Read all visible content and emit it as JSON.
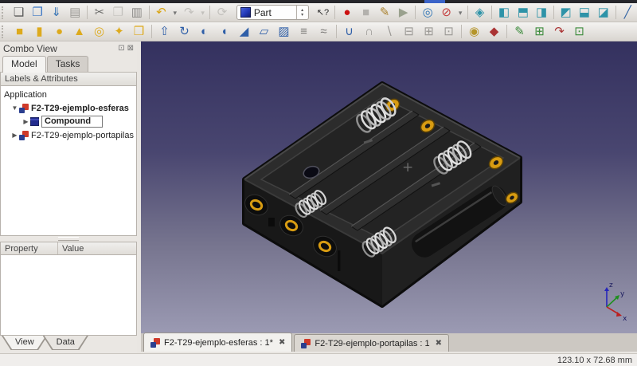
{
  "colors": {
    "viewport_gradient_top": "#34315f",
    "viewport_gradient_bottom": "#9b9ab3",
    "primitive_icon": "#ddaa1d",
    "modify_icon": "#2f5fa8",
    "view_icon": "#2e93a8",
    "record_icon": "#cc1111",
    "undo_icon": "#d9a410"
  },
  "toolbar_file": {
    "items": [
      {
        "name": "new-file",
        "glyph": "❏",
        "style": "color:#5a5a5a"
      },
      {
        "name": "open-file",
        "glyph": "❐",
        "style": "color:#3a76c4"
      },
      {
        "name": "save-file",
        "glyph": "⇓",
        "style": "color:#2f6fb3"
      },
      {
        "name": "print",
        "glyph": "▤",
        "style": "color:#9a9894"
      },
      {
        "name": "cut",
        "glyph": "✂",
        "style": "color:#6f6f6d"
      },
      {
        "name": "copy",
        "glyph": "❐",
        "style": "color:#c3c1bd"
      },
      {
        "name": "paste",
        "glyph": "▥",
        "style": "color:#8a8886"
      },
      {
        "name": "undo",
        "glyph": "↶",
        "style": "color:#d9a410"
      },
      {
        "name": "undo-menu",
        "glyph": "▾",
        "style": "color:#777777"
      },
      {
        "name": "redo",
        "glyph": "↷",
        "style": "color:#c3c1bd"
      },
      {
        "name": "redo-menu",
        "glyph": "▾",
        "style": "color:#c3c1bd"
      },
      {
        "name": "refresh",
        "glyph": "⟳",
        "style": "color:#c3c1bd"
      },
      {
        "name": "whats-this",
        "glyph": "↖?",
        "style": "color:#2a2a2a;font-size:11px"
      },
      {
        "name": "macro-record",
        "glyph": "●",
        "style": "color:#cc1111"
      },
      {
        "name": "macro-stop",
        "glyph": "■",
        "style": "color:#b3b1ad"
      },
      {
        "name": "macro-edit",
        "glyph": "✎",
        "style": "color:#a87f2a"
      },
      {
        "name": "macro-play",
        "glyph": "▶",
        "style": "color:#9aa18e"
      },
      {
        "name": "fit-all",
        "glyph": "◎",
        "style": "color:#2e74b5"
      },
      {
        "name": "draw-style",
        "glyph": "⊘",
        "style": "color:#c43c3c"
      },
      {
        "name": "draw-style-menu",
        "glyph": "▾",
        "style": "color:#777777"
      },
      {
        "name": "view-isometric",
        "glyph": "◈",
        "style": "color:#2e93a8"
      },
      {
        "name": "view-front",
        "glyph": "◧",
        "style": "color:#2e93a8"
      },
      {
        "name": "view-top",
        "glyph": "◧",
        "style": "color:#2e93a8;transform:rotate(90deg)"
      },
      {
        "name": "view-right",
        "glyph": "◨",
        "style": "color:#2e93a8"
      },
      {
        "name": "view-rear",
        "glyph": "◩",
        "style": "color:#2e93a8"
      },
      {
        "name": "view-bottom",
        "glyph": "◨",
        "style": "color:#2e93a8;transform:rotate(90deg)"
      },
      {
        "name": "view-left",
        "glyph": "◪",
        "style": "color:#2e93a8"
      },
      {
        "name": "measure-distance",
        "glyph": "╱",
        "style": "color:#3565a5"
      }
    ]
  },
  "workbench_selector": {
    "value": "Part",
    "stepper_up": "▴",
    "stepper_down": "▾"
  },
  "toolbar_part": {
    "items": [
      {
        "name": "box",
        "glyph": "■",
        "style": "color:#ddaa1d"
      },
      {
        "name": "cylinder",
        "glyph": "▮",
        "style": "color:#ddaa1d"
      },
      {
        "name": "sphere",
        "glyph": "●",
        "style": "color:#ddaa1d"
      },
      {
        "name": "cone",
        "glyph": "▲",
        "style": "color:#ddaa1d"
      },
      {
        "name": "torus",
        "glyph": "◎",
        "style": "color:#ddaa1d"
      },
      {
        "name": "create-primitives",
        "glyph": "✦",
        "style": "color:#ddaa1d"
      },
      {
        "name": "shape-builder",
        "glyph": "❒",
        "style": "color:#ddaa1d"
      },
      {
        "name": "extrude",
        "glyph": "⇧",
        "style": "color:#2f5fa8"
      },
      {
        "name": "revolve",
        "glyph": "↻",
        "style": "color:#2f5fa8"
      },
      {
        "name": "mirror",
        "glyph": "◐",
        "style": "color:#2f5fa8"
      },
      {
        "name": "fillet",
        "glyph": "◖",
        "style": "color:#2f5fa8"
      },
      {
        "name": "chamfer",
        "glyph": "◢",
        "style": "color:#2f5fa8"
      },
      {
        "name": "make-face",
        "glyph": "▱",
        "style": "color:#2f5fa8"
      },
      {
        "name": "ruled-surface",
        "glyph": "▨",
        "style": "color:#2f5fa8"
      },
      {
        "name": "loft",
        "glyph": "≡",
        "style": "color:#7a7876"
      },
      {
        "name": "sweep",
        "glyph": "≈",
        "style": "color:#7a7876"
      },
      {
        "name": "boolean-union",
        "glyph": "∪",
        "style": "color:#2f5fa8"
      },
      {
        "name": "boolean-common",
        "glyph": "∩",
        "style": "color:#9a9894"
      },
      {
        "name": "boolean-cut",
        "glyph": "∖",
        "style": "color:#9a9894"
      },
      {
        "name": "section",
        "glyph": "⊟",
        "style": "color:#9a9894"
      },
      {
        "name": "cross-sections",
        "glyph": "⊞",
        "style": "color:#9a9894"
      },
      {
        "name": "compound-tool",
        "glyph": "⊡",
        "style": "color:#9a9894"
      },
      {
        "name": "check-geometry",
        "glyph": "◉",
        "style": "color:#b5952a"
      },
      {
        "name": "defeaturing",
        "glyph": "◆",
        "style": "color:#aa3333"
      },
      {
        "name": "sketch-create",
        "glyph": "✎",
        "style": "color:#3a8a3a"
      },
      {
        "name": "sketch-map",
        "glyph": "⊞",
        "style": "color:#3a8a3a"
      },
      {
        "name": "sketch-reorient",
        "glyph": "↷",
        "style": "color:#aa3333"
      },
      {
        "name": "sketch-validate",
        "glyph": "⊡",
        "style": "color:#3a8a3a"
      }
    ]
  },
  "combo_view": {
    "title": "Combo View",
    "float_icon": "⊡",
    "close_icon": "⊠",
    "tabs": [
      {
        "label": "Model"
      },
      {
        "label": "Tasks"
      }
    ],
    "tree_header": "Labels & Attributes",
    "tree": {
      "root_label": "Application",
      "items": [
        {
          "expander": "▼",
          "label": "F2-T29-ejemplo-esferas"
        },
        {
          "expander": "▶",
          "label": "Compound"
        },
        {
          "expander": "▶",
          "label": "F2-T29-ejemplo-portapilas"
        }
      ]
    }
  },
  "property_editor": {
    "columns": [
      "Property",
      "Value"
    ],
    "tabs": [
      "View",
      "Data"
    ]
  },
  "document_tabs": [
    {
      "label": "F2-T29-ejemplo-esferas : 1*",
      "close_icon": "✖"
    },
    {
      "label": "F2-T29-ejemplo-portapilas : 1",
      "close_icon": "✖"
    }
  ],
  "viewport": {
    "plus_marking": "+",
    "axis": {
      "x": "x",
      "y": "y",
      "z": "z"
    }
  },
  "status_bar": {
    "dimensions": "123.10 x 72.68 mm"
  }
}
